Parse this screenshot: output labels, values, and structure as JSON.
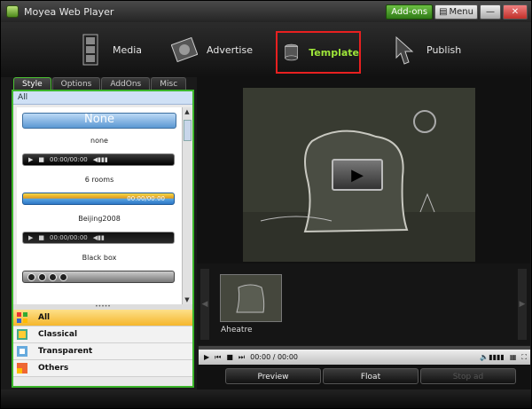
{
  "window": {
    "title": "Moyea Web Player",
    "addons": "Add-ons",
    "menu": "Menu",
    "minimize": "—",
    "close": "✕"
  },
  "toolbar": {
    "media": "Media",
    "advertise": "Advertise",
    "template": "Template",
    "publish": "Publish"
  },
  "tabs": [
    "Style",
    "Options",
    "AddOns",
    "Misc"
  ],
  "list_header": "All",
  "skins": [
    {
      "name": "none",
      "label": "None"
    },
    {
      "name": "6 rooms",
      "time": "00:00/00:00"
    },
    {
      "name": "Beijing2008",
      "time": "00:00/00:00"
    },
    {
      "name": "Black box",
      "time": "00:00/00:00"
    },
    {
      "name": ""
    }
  ],
  "categories": [
    "All",
    "Classical",
    "Transparent",
    "Others"
  ],
  "thumbnail": {
    "label": "Aheatre"
  },
  "player": {
    "time": "00:00 / 00:00"
  },
  "buttons": {
    "preview": "Preview",
    "float": "Float",
    "stop_ad": "Stop ad"
  },
  "colors": {
    "accent_green": "#3bb52a",
    "highlight_red": "#e82020",
    "template_text": "#9ee53a"
  }
}
